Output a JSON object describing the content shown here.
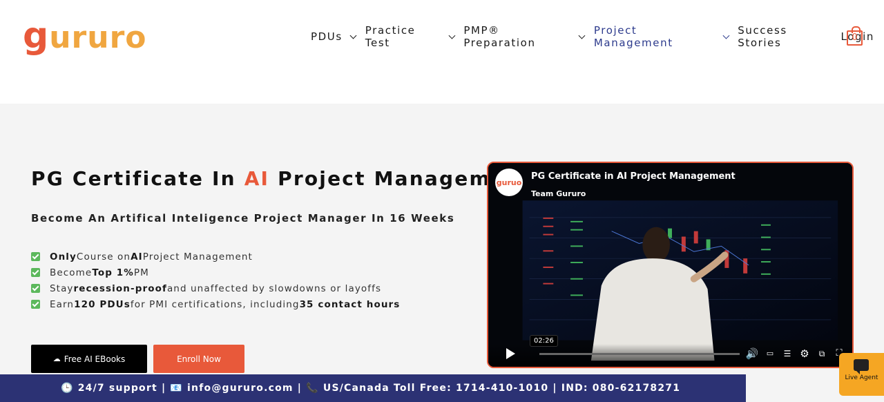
{
  "brand": {
    "logo_first": "g",
    "logo_rest": "ururo",
    "accent": "#e8593a",
    "secondary": "#f0a640"
  },
  "nav": {
    "items": [
      {
        "label": "PDUs",
        "has_dropdown": true
      },
      {
        "label": "Practice Test",
        "has_dropdown": true
      },
      {
        "label": "PMP® Preparation",
        "has_dropdown": true
      },
      {
        "label": "Project Management",
        "has_dropdown": true,
        "active": true
      },
      {
        "label": "Success Stories",
        "has_dropdown": false
      },
      {
        "label": "Login",
        "has_dropdown": false
      }
    ],
    "cart_count": "0"
  },
  "hero": {
    "title_pre": "PG Certificate In ",
    "title_ai": "AI",
    "title_post": " Project Management",
    "subtitle_pre": "Become An Artifical Inteligence Project Manager In ",
    "subtitle_bold": "16 Weeks",
    "bullets": [
      {
        "parts": [
          {
            "b": "Only"
          },
          {
            "t": " Course on "
          },
          {
            "b": "AI"
          },
          {
            "t": " Project Management"
          }
        ]
      },
      {
        "parts": [
          {
            "t": "Become "
          },
          {
            "b": "Top 1%"
          },
          {
            "t": " PM"
          }
        ]
      },
      {
        "parts": [
          {
            "t": "Stay "
          },
          {
            "b": "recession-proof"
          },
          {
            "t": " and unaffected by slowdowns or layoffs"
          }
        ]
      },
      {
        "parts": [
          {
            "t": "Earn "
          },
          {
            "b": "120 PDUs"
          },
          {
            "t": " for PMI certifications, including "
          },
          {
            "b": "35 contact hours"
          }
        ]
      }
    ],
    "btn_ebooks": "Free AI EBooks",
    "btn_enroll": "Enroll Now"
  },
  "video": {
    "logo_text": "guruo",
    "title": "PG Certificate in AI Project Management",
    "channel": "Team Gururo",
    "timestamp": "02:26"
  },
  "footer": {
    "support_text": "🕒 24/7 support | 📧 info@gururo.com | 📞 US/Canada Toll Free: 1714-410-1010 | IND: 080-62178271"
  },
  "live_agent": {
    "label": "Live Agent"
  }
}
